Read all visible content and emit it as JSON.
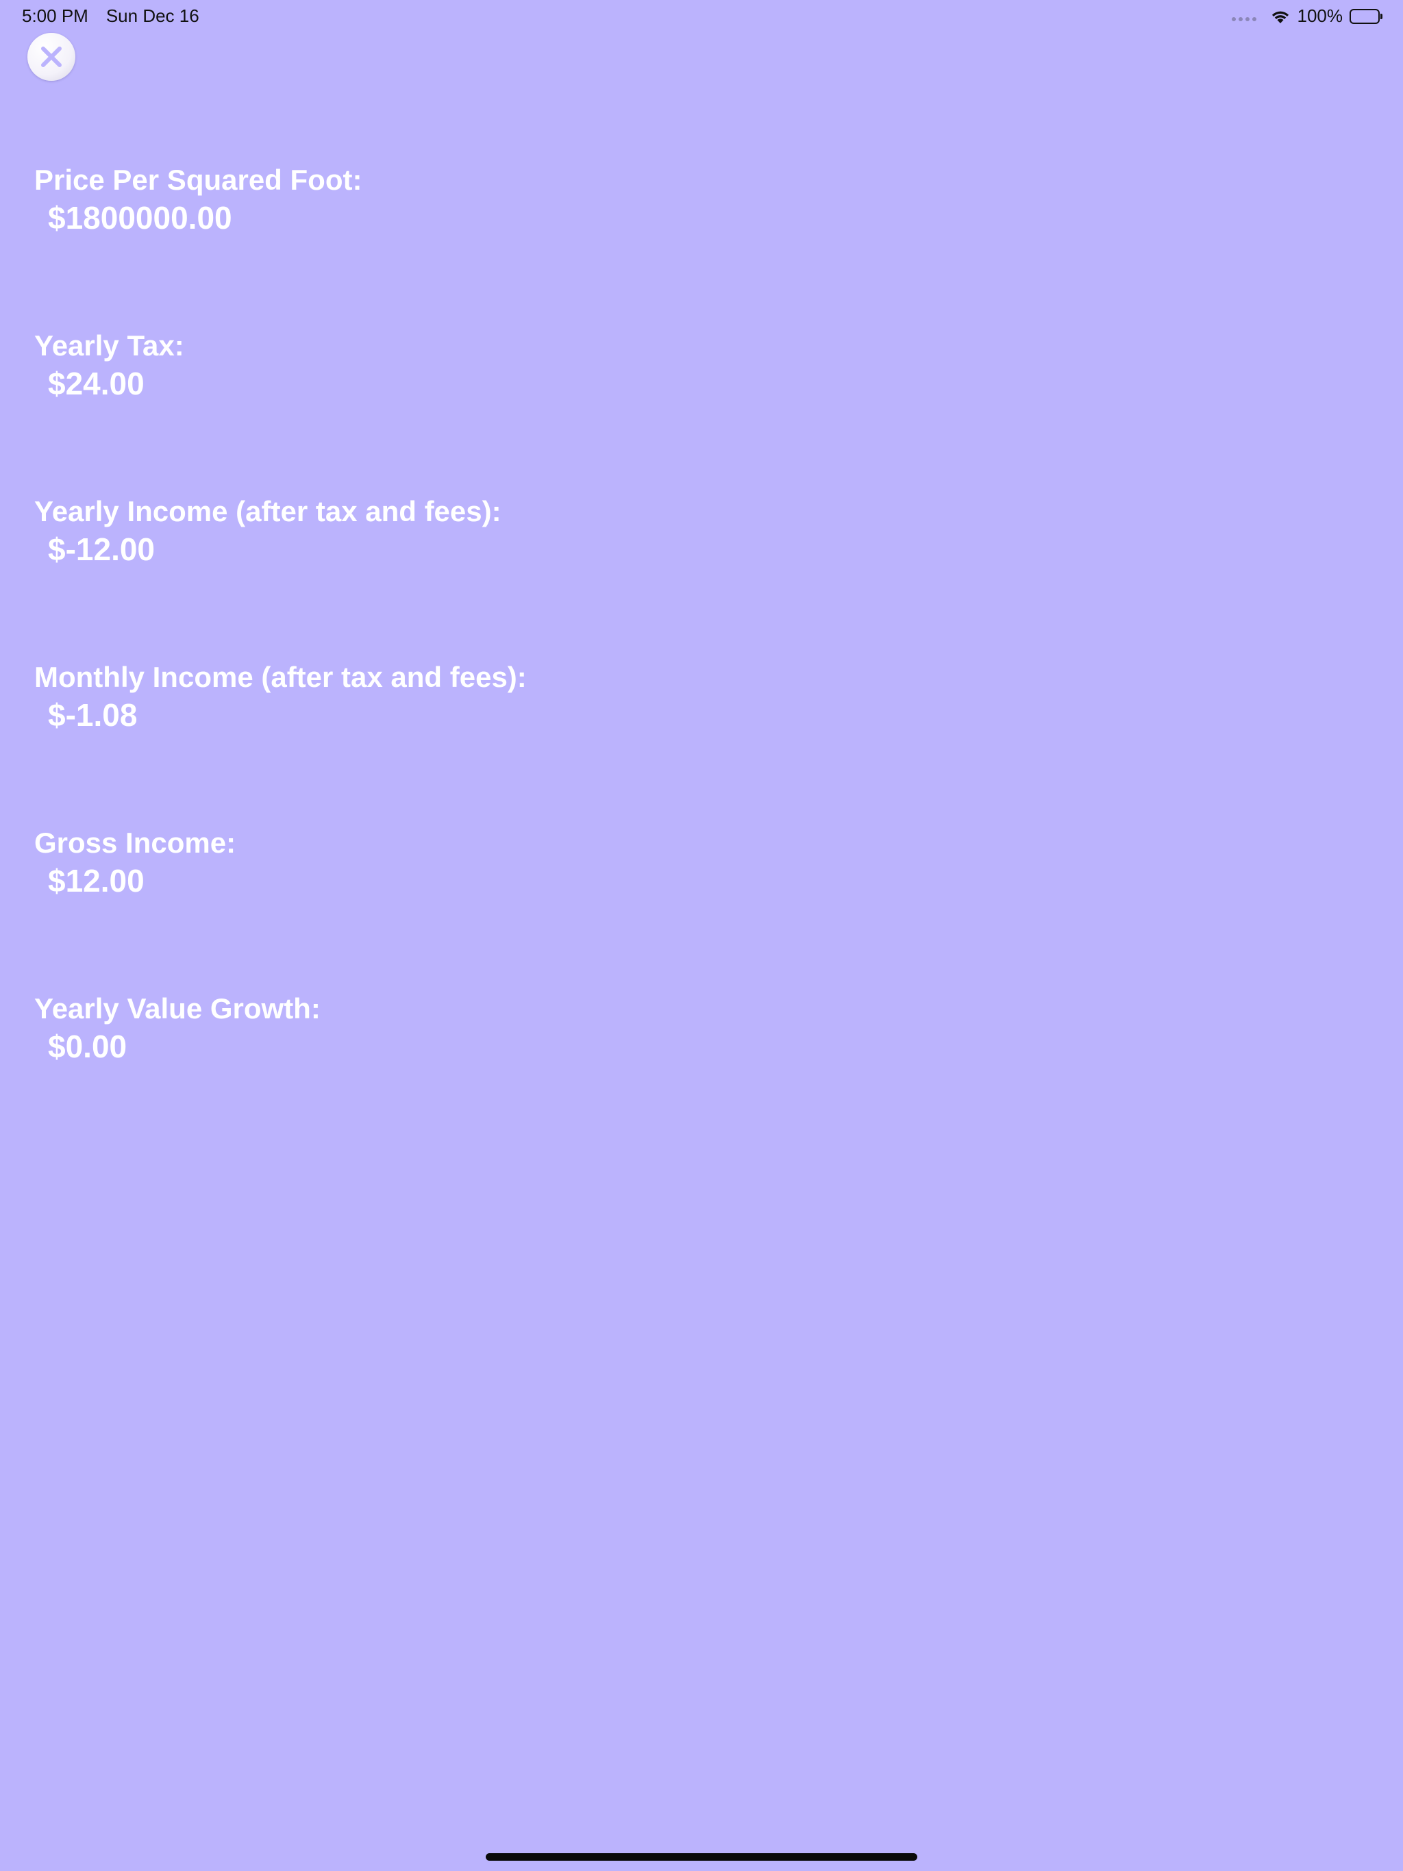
{
  "status_bar": {
    "time": "5:00 PM",
    "date": "Sun Dec 16",
    "battery_percent": "100%",
    "battery_level": 1.0,
    "icons": [
      "signal-dots-icon",
      "wifi-icon",
      "battery-icon"
    ]
  },
  "close_button": {
    "icon": "close-icon",
    "icon_color": "#BBB3FD"
  },
  "results": [
    {
      "label": "Price Per Squared Foot:",
      "value": "$1800000.00"
    },
    {
      "label": "Yearly Tax:",
      "value": "$24.00"
    },
    {
      "label": "Yearly Income (after tax and fees):",
      "value": "$-12.00"
    },
    {
      "label": "Monthly Income (after tax and fees):",
      "value": "$-1.08"
    },
    {
      "label": "Gross Income:",
      "value": "$12.00"
    },
    {
      "label": "Yearly Value Growth:",
      "value": "$0.00"
    }
  ],
  "colors": {
    "background": "#BBB3FD",
    "text": "#FFFFFF"
  }
}
